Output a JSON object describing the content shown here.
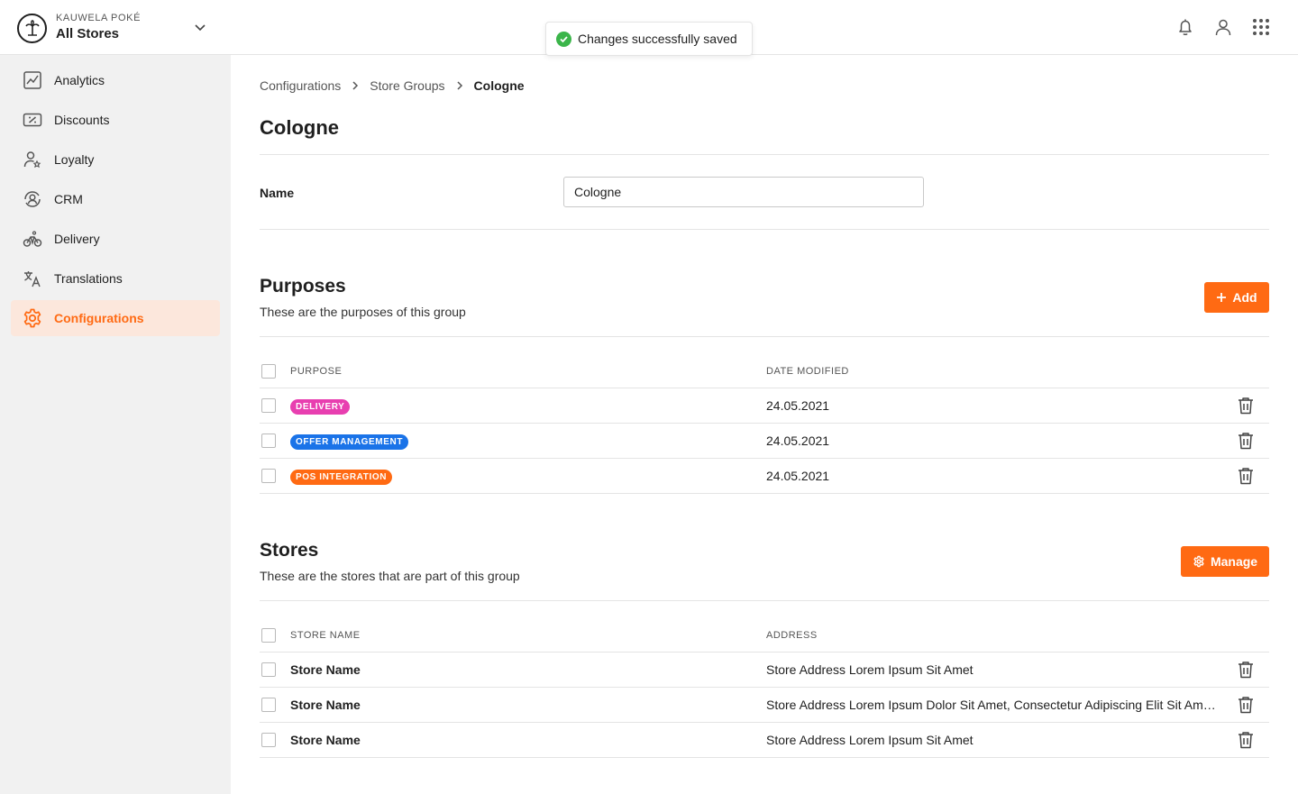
{
  "header": {
    "company": "KAUWELA POKÉ",
    "store_selector": "All Stores",
    "toast": "Changes successfully saved",
    "icons": [
      "bell-icon",
      "user-icon",
      "apps-grid-icon"
    ]
  },
  "sidebar": {
    "items": [
      {
        "label": "Analytics",
        "icon": "analytics-icon"
      },
      {
        "label": "Discounts",
        "icon": "discount-icon"
      },
      {
        "label": "Loyalty",
        "icon": "loyalty-icon"
      },
      {
        "label": "CRM",
        "icon": "crm-icon"
      },
      {
        "label": "Delivery",
        "icon": "bicycle-icon"
      },
      {
        "label": "Translations",
        "icon": "translate-icon"
      },
      {
        "label": "Configurations",
        "icon": "gear-icon",
        "active": true
      }
    ]
  },
  "breadcrumb": [
    "Configurations",
    "Store Groups",
    "Cologne"
  ],
  "page": {
    "title": "Cologne",
    "name_label": "Name",
    "name_value": "Cologne"
  },
  "purposes": {
    "title": "Purposes",
    "subtitle": "These are the purposes of this group",
    "add_label": "Add",
    "columns": [
      "PURPOSE",
      "DATE MODIFIED"
    ],
    "rows": [
      {
        "tag": "DELIVERY",
        "color": "#e83fb0",
        "date": "24.05.2021"
      },
      {
        "tag": "OFFER MANAGEMENT",
        "color": "#1a73e8",
        "date": "24.05.2021"
      },
      {
        "tag": "POS INTEGRATION",
        "color": "#ff6a13",
        "date": "24.05.2021"
      }
    ]
  },
  "stores": {
    "title": "Stores",
    "subtitle": "These are the stores that are part of this group",
    "manage_label": "Manage",
    "columns": [
      "STORE NAME",
      "ADDRESS"
    ],
    "rows": [
      {
        "name": "Store Name",
        "address": "Store Address Lorem Ipsum Sit Amet"
      },
      {
        "name": "Store Name",
        "address": "Store Address Lorem Ipsum Dolor Sit Amet, Consectetur Adipiscing Elit Sit Amet Lorem"
      },
      {
        "name": "Store Name",
        "address": "Store Address Lorem Ipsum Sit Amet"
      }
    ]
  },
  "colors": {
    "accent": "#ff6a13",
    "accent_bg": "#fce7dc",
    "success": "#3bb54a"
  }
}
